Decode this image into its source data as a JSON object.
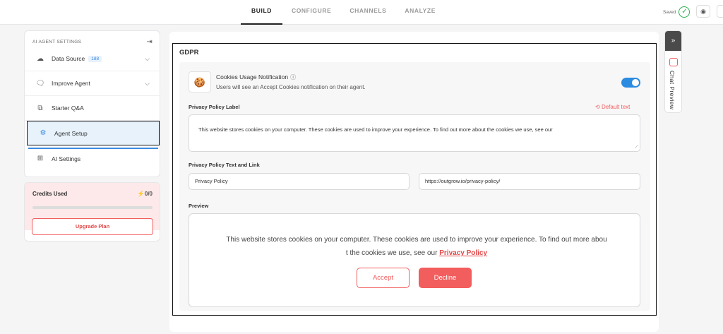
{
  "nav": {
    "tabs": [
      "BUILD",
      "CONFIGURE",
      "CHANNELS",
      "ANALYZE"
    ],
    "saved_label": "Saved"
  },
  "sidebar": {
    "title": "AI AGENT SETTINGS",
    "items": [
      {
        "label": "Data Source",
        "badge": "188",
        "icon": "cloud-icon"
      },
      {
        "label": "Improve Agent",
        "icon": "chat-bubble-icon"
      },
      {
        "label": "Starter Q&A",
        "icon": "qa-icon"
      },
      {
        "label": "Agent Setup",
        "icon": "gear-icon"
      },
      {
        "label": "AI Settings",
        "icon": "ai-settings-icon"
      }
    ]
  },
  "credits": {
    "title": "Credits Used",
    "count": "0/0",
    "progress": 0,
    "upgrade_label": "Upgrade Plan"
  },
  "gdpr": {
    "title": "GDPR",
    "notification_title": "Cookies Usage Notification",
    "notification_subtitle": "Users will see an Accept Cookies notification on their agent.",
    "toggle_on": true,
    "policy_label_title": "Privacy Policy Label",
    "default_text_link": "Default text",
    "policy_label_value": "This website stores cookies on your computer. These cookies are used to improve your experience. To find out more about the cookies we use, see our",
    "text_and_link_title": "Privacy Policy Text and Link",
    "link_text_value": "Privacy Policy",
    "link_url_value": "https://outgrow.io/privacy-policy/",
    "preview_title": "Preview",
    "preview_text_line1": "This website stores cookies on your computer. These cookies are used to improve your experience. To find out more abou",
    "preview_text_line2": "t the cookies we use, see our",
    "preview_link": "Privacy Policy",
    "accept_label": "Accept",
    "decline_label": "Decline"
  },
  "chat_preview": {
    "label": "Chat Preview"
  },
  "colors": {
    "accent": "#f25d5d",
    "toggle": "#2b8be0",
    "saved": "#2bb24c"
  }
}
